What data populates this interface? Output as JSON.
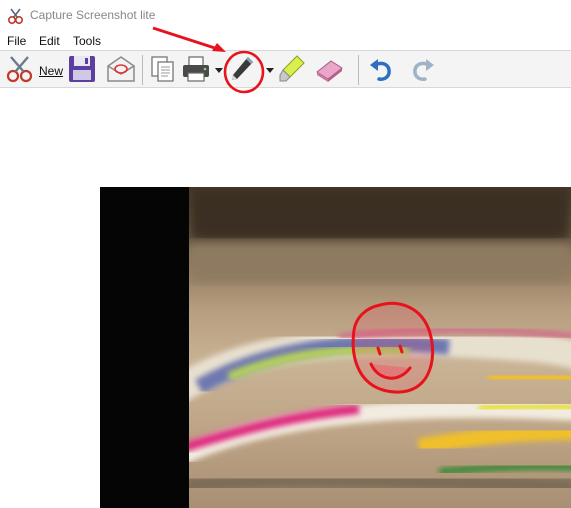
{
  "window": {
    "title": "Capture Screenshot lite"
  },
  "menu": {
    "items": [
      "File",
      "Edit",
      "Tools"
    ]
  },
  "toolbar": {
    "new_label": "New",
    "tools": [
      {
        "name": "new",
        "icon": "scissors-icon"
      },
      {
        "name": "save",
        "icon": "floppy-disk-icon"
      },
      {
        "name": "email",
        "icon": "envelope-icon"
      },
      {
        "name": "copy",
        "icon": "copy-icon"
      },
      {
        "name": "print",
        "icon": "printer-icon",
        "dropdown": true
      },
      {
        "name": "pen",
        "icon": "pen-icon",
        "dropdown": true,
        "active": true
      },
      {
        "name": "highlighter",
        "icon": "highlighter-icon"
      },
      {
        "name": "eraser",
        "icon": "eraser-icon"
      },
      {
        "name": "undo",
        "icon": "undo-icon"
      },
      {
        "name": "redo",
        "icon": "redo-icon",
        "disabled": true
      }
    ]
  },
  "annotation": {
    "color": "#e8121c"
  }
}
